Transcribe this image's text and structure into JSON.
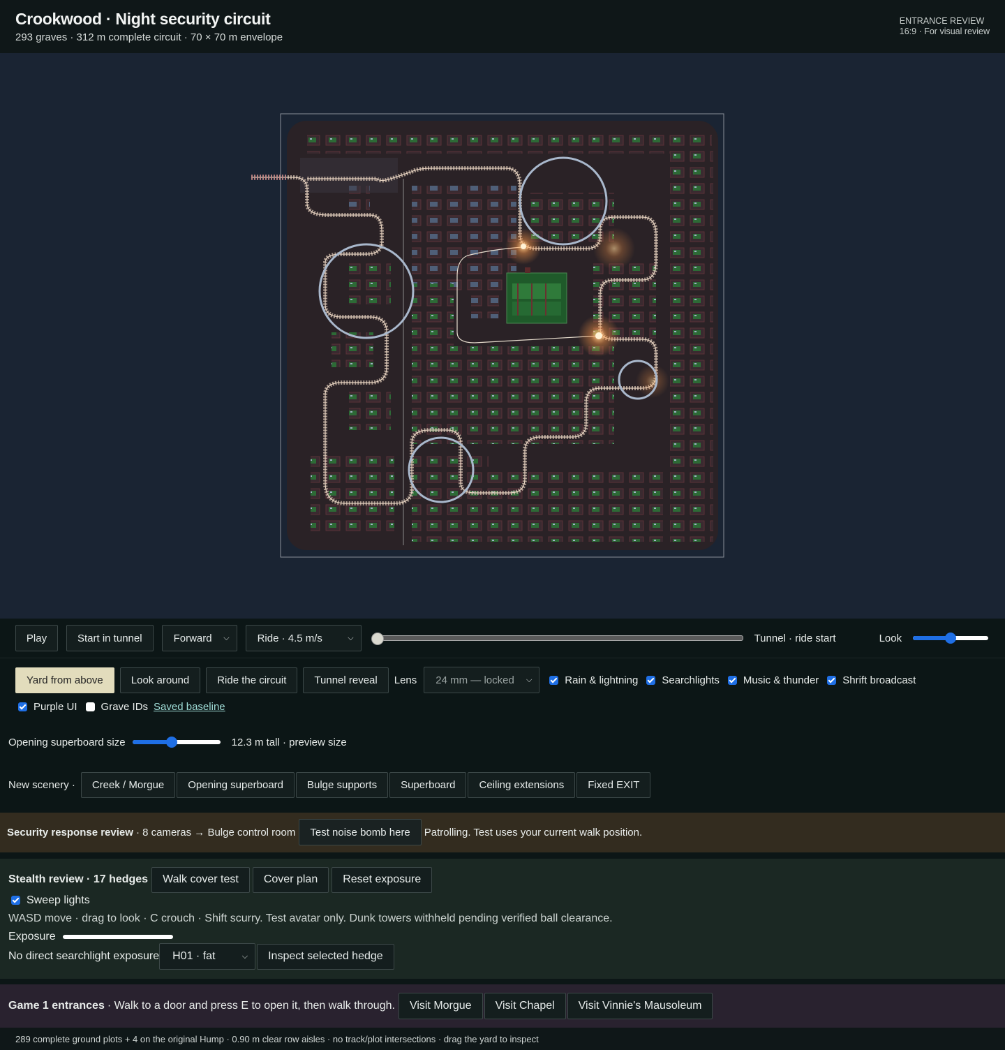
{
  "header": {
    "title": "Crookwood · Night security circuit",
    "subtitle": "293 graves · 312 m complete circuit · 70 × 70 m envelope",
    "review_label": "ENTRANCE REVIEW",
    "review_sub": "16:9 · For visual review"
  },
  "transport": {
    "play": "Play",
    "start_tunnel": "Start in tunnel",
    "direction": "Forward",
    "speed": "Ride · 4.5 m/s",
    "progress": 0,
    "position_label": "Tunnel · ride start",
    "look_label": "Look",
    "look_value": 0.5
  },
  "views": {
    "yard_from_above": "Yard from above",
    "look_around": "Look around",
    "ride_circuit": "Ride the circuit",
    "tunnel_reveal": "Tunnel reveal",
    "lens_label": "Lens",
    "lens_value": "24 mm — locked"
  },
  "toggles": {
    "rain": "Rain & lightning",
    "searchlights": "Searchlights",
    "music": "Music & thunder",
    "shrift": "Shrift broadcast",
    "purple_ui": "Purple UI",
    "grave_ids": "Grave IDs",
    "saved_baseline": "Saved baseline"
  },
  "superboard": {
    "label": "Opening superboard size",
    "value": 0.45,
    "readout": "12.3 m tall · preview size"
  },
  "scenery": {
    "label": "New scenery ·",
    "items": [
      "Creek / Morgue",
      "Opening superboard",
      "Bulge supports",
      "Superboard",
      "Ceiling extensions",
      "Fixed EXIT"
    ]
  },
  "security": {
    "title": "Security response review",
    "detail": "· 8 cameras → Bulge control room",
    "button": "Test noise bomb here",
    "status": "Patrolling. Test uses your current walk position."
  },
  "stealth": {
    "title": "Stealth review · 17 hedges",
    "walk_cover": "Walk cover test",
    "cover_plan": "Cover plan",
    "reset_exposure": "Reset exposure",
    "sweep_lights": "Sweep lights",
    "help": "WASD move · drag to look · C crouch · Shift scurry. Test avatar only. Dunk towers withheld pending verified ball clearance.",
    "exposure_label": "Exposure",
    "exposure_status": "No direct searchlight exposure",
    "hedge_select": "H01 · fat",
    "inspect": "Inspect selected hedge"
  },
  "game": {
    "title": "Game 1 entrances",
    "detail": "· Walk to a door and press E to open it, then walk through.",
    "visit_morgue": "Visit Morgue",
    "visit_chapel": "Visit Chapel",
    "visit_vinnie": "Visit Vinnie's Mausoleum"
  },
  "footer": {
    "text": "289 complete ground plots + 4 on the original Hump · 0.90 m clear row aisles · no track/plot intersections · drag the yard to inspect"
  },
  "colors": {
    "viewport_bg": "#1a2433",
    "yard_ground": "#2a2226",
    "track_rail": "#c9b7a6",
    "camera_ring": "#a9b8cc",
    "chapel_green": "#2f7a3a",
    "lamp_glow": "#ffb866",
    "active_button": "#e2dcbc",
    "accent_blue": "#1f6fe5"
  }
}
